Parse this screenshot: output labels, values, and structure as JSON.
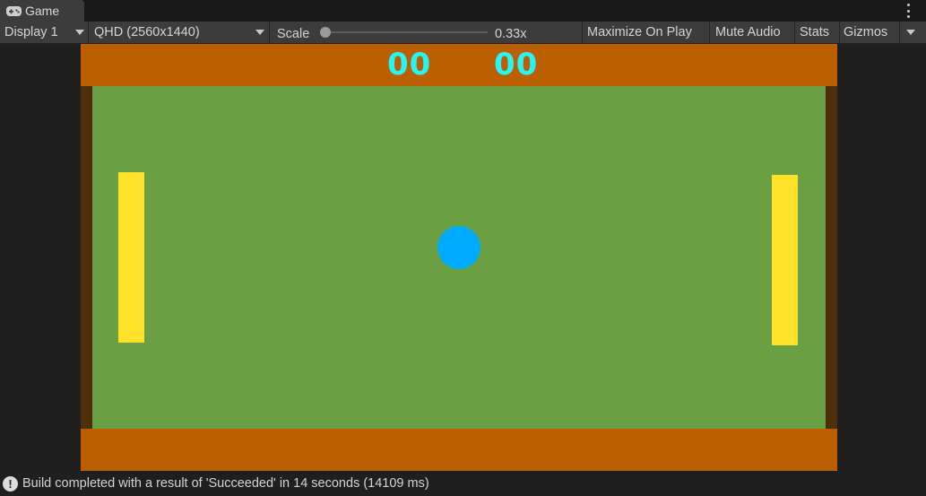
{
  "tab": {
    "title": "Game",
    "icon": "gamepad-icon"
  },
  "toolbar": {
    "display": "Display 1",
    "resolution": "QHD (2560x1440)",
    "scale_label": "Scale",
    "scale_value": "0.33x",
    "maximize": "Maximize On Play",
    "mute": "Mute Audio",
    "stats": "Stats",
    "gizmos": "Gizmos"
  },
  "game": {
    "score_left": "00",
    "score_right": "00",
    "colors": {
      "wall_bar": "#bc5f00",
      "side_wall": "#4e2e0b",
      "field": "#6a9f43",
      "paddle": "#ffe12a",
      "ball": "#00aaff",
      "score": "#27f5f5"
    }
  },
  "status": {
    "icon": "info-icon",
    "message": "Build completed with a result of 'Succeeded' in 14 seconds (14109 ms)"
  }
}
